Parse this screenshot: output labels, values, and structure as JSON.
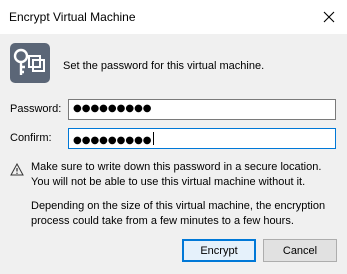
{
  "window": {
    "title": "Encrypt Virtual Machine"
  },
  "icons": {
    "close": "close-icon",
    "key": "key-icon",
    "warning": "warning-icon"
  },
  "intro": "Set the password for this virtual machine.",
  "password": {
    "label": "Password:",
    "masked_value": "●●●●●●●●●"
  },
  "confirm": {
    "label": "Confirm:",
    "masked_value": "●●●●●●●●●"
  },
  "warning": "Make sure to write down this password in a secure location. You will not be able to use this virtual machine without it.",
  "note": "Depending on the size of this virtual machine, the encryption process could take from a few minutes to a few hours.",
  "buttons": {
    "encrypt": "Encrypt",
    "cancel": "Cancel"
  },
  "colors": {
    "accent": "#0078d7",
    "dialog_bg": "#f0f0f0"
  }
}
